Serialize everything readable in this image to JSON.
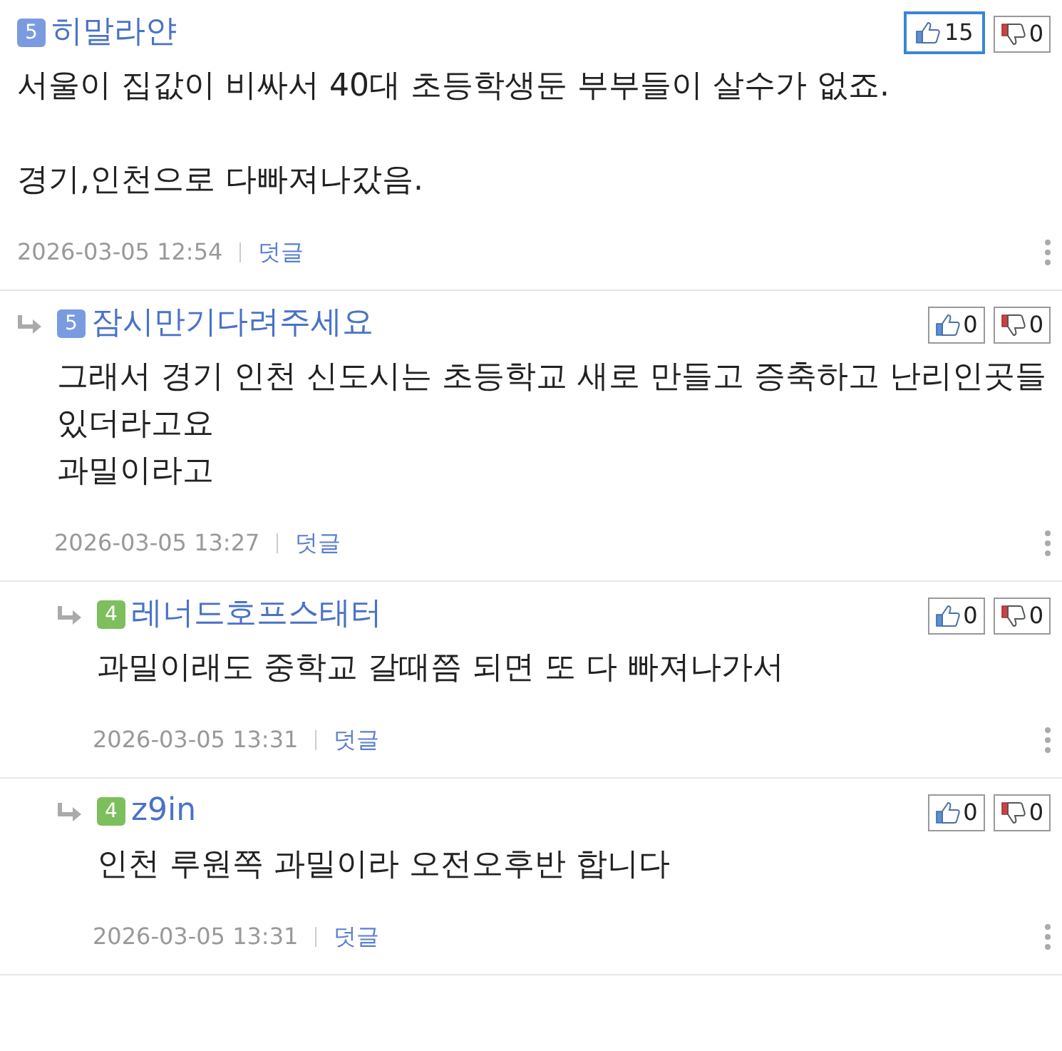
{
  "comments": [
    {
      "author": "히말라얀",
      "level": "5",
      "color": "#7b9be0",
      "likes": "15",
      "liked": true,
      "dislikes": "0",
      "paragraphs": [
        [
          "서울이 집값이 비싸서 40대 초등학생둔 부부들이 살수가 없죠."
        ],
        [
          "경기,인천으로 다빠져나갔음."
        ]
      ],
      "date": "2026-03-05 12:54",
      "reply_label": "덧글",
      "children": [
        {
          "author": "잠시만기다려주세요",
          "level": "5",
          "color": "#7b9be0",
          "likes": "0",
          "liked": false,
          "dislikes": "0",
          "paragraphs": [
            [
              "그래서 경기 인천 신도시는 초등학교 새로 만들고 증축하고 난리인곳들 있더라고요",
              "과밀이라고"
            ]
          ],
          "date": "2026-03-05 13:27",
          "reply_label": "덧글",
          "children": [
            {
              "author": "레너드호프스태터",
              "level": "4",
              "color": "#7cbf5c",
              "likes": "0",
              "liked": false,
              "dislikes": "0",
              "paragraphs": [
                [
                  "과밀이래도 중학교 갈때쯤 되면 또 다 빠져나가서"
                ]
              ],
              "date": "2026-03-05 13:31",
              "reply_label": "덧글"
            },
            {
              "author": "z9in",
              "level": "4",
              "color": "#7cbf5c",
              "likes": "0",
              "liked": false,
              "dislikes": "0",
              "paragraphs": [
                [
                  "인천 루원쪽 과밀이라 오전오후반 합니다"
                ]
              ],
              "date": "2026-03-05 13:31",
              "reply_label": "덧글"
            }
          ]
        }
      ]
    }
  ]
}
